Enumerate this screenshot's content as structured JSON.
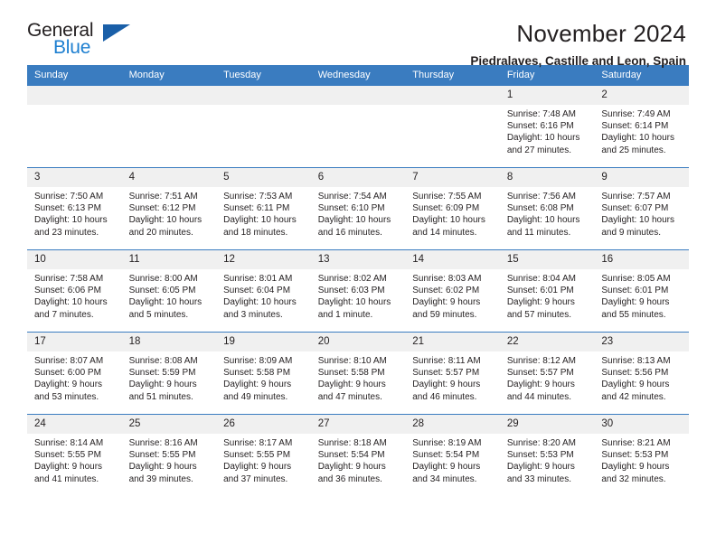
{
  "logo": {
    "primary_text": "General",
    "secondary_text": "Blue",
    "primary_color": "#231f20",
    "secondary_color": "#1d7fd0",
    "triangle_color": "#1a5fa8",
    "triangle_icon": "triangle-icon"
  },
  "header": {
    "title": "November 2024",
    "subtitle": "Piedralaves, Castille and Leon, Spain"
  },
  "theme": {
    "header_row_bg": "#3a7cc0",
    "header_row_text": "#ffffff",
    "daynum_bg": "#f0f0f0",
    "cell_bg": "#ffffff",
    "row_border": "#3a7cc0",
    "text": "#231f20"
  },
  "weekdays": [
    "Sunday",
    "Monday",
    "Tuesday",
    "Wednesday",
    "Thursday",
    "Friday",
    "Saturday"
  ],
  "labels": {
    "sunrise_prefix": "Sunrise: ",
    "sunset_prefix": "Sunset: ",
    "daylight_prefix": "Daylight: "
  },
  "weeks": [
    [
      {
        "day": "",
        "blank": true
      },
      {
        "day": "",
        "blank": true
      },
      {
        "day": "",
        "blank": true
      },
      {
        "day": "",
        "blank": true
      },
      {
        "day": "",
        "blank": true
      },
      {
        "day": "1",
        "sunrise": "Sunrise: 7:48 AM",
        "sunset": "Sunset: 6:16 PM",
        "daylight": "Daylight: 10 hours and 27 minutes."
      },
      {
        "day": "2",
        "sunrise": "Sunrise: 7:49 AM",
        "sunset": "Sunset: 6:14 PM",
        "daylight": "Daylight: 10 hours and 25 minutes."
      }
    ],
    [
      {
        "day": "3",
        "sunrise": "Sunrise: 7:50 AM",
        "sunset": "Sunset: 6:13 PM",
        "daylight": "Daylight: 10 hours and 23 minutes."
      },
      {
        "day": "4",
        "sunrise": "Sunrise: 7:51 AM",
        "sunset": "Sunset: 6:12 PM",
        "daylight": "Daylight: 10 hours and 20 minutes."
      },
      {
        "day": "5",
        "sunrise": "Sunrise: 7:53 AM",
        "sunset": "Sunset: 6:11 PM",
        "daylight": "Daylight: 10 hours and 18 minutes."
      },
      {
        "day": "6",
        "sunrise": "Sunrise: 7:54 AM",
        "sunset": "Sunset: 6:10 PM",
        "daylight": "Daylight: 10 hours and 16 minutes."
      },
      {
        "day": "7",
        "sunrise": "Sunrise: 7:55 AM",
        "sunset": "Sunset: 6:09 PM",
        "daylight": "Daylight: 10 hours and 14 minutes."
      },
      {
        "day": "8",
        "sunrise": "Sunrise: 7:56 AM",
        "sunset": "Sunset: 6:08 PM",
        "daylight": "Daylight: 10 hours and 11 minutes."
      },
      {
        "day": "9",
        "sunrise": "Sunrise: 7:57 AM",
        "sunset": "Sunset: 6:07 PM",
        "daylight": "Daylight: 10 hours and 9 minutes."
      }
    ],
    [
      {
        "day": "10",
        "sunrise": "Sunrise: 7:58 AM",
        "sunset": "Sunset: 6:06 PM",
        "daylight": "Daylight: 10 hours and 7 minutes."
      },
      {
        "day": "11",
        "sunrise": "Sunrise: 8:00 AM",
        "sunset": "Sunset: 6:05 PM",
        "daylight": "Daylight: 10 hours and 5 minutes."
      },
      {
        "day": "12",
        "sunrise": "Sunrise: 8:01 AM",
        "sunset": "Sunset: 6:04 PM",
        "daylight": "Daylight: 10 hours and 3 minutes."
      },
      {
        "day": "13",
        "sunrise": "Sunrise: 8:02 AM",
        "sunset": "Sunset: 6:03 PM",
        "daylight": "Daylight: 10 hours and 1 minute."
      },
      {
        "day": "14",
        "sunrise": "Sunrise: 8:03 AM",
        "sunset": "Sunset: 6:02 PM",
        "daylight": "Daylight: 9 hours and 59 minutes."
      },
      {
        "day": "15",
        "sunrise": "Sunrise: 8:04 AM",
        "sunset": "Sunset: 6:01 PM",
        "daylight": "Daylight: 9 hours and 57 minutes."
      },
      {
        "day": "16",
        "sunrise": "Sunrise: 8:05 AM",
        "sunset": "Sunset: 6:01 PM",
        "daylight": "Daylight: 9 hours and 55 minutes."
      }
    ],
    [
      {
        "day": "17",
        "sunrise": "Sunrise: 8:07 AM",
        "sunset": "Sunset: 6:00 PM",
        "daylight": "Daylight: 9 hours and 53 minutes."
      },
      {
        "day": "18",
        "sunrise": "Sunrise: 8:08 AM",
        "sunset": "Sunset: 5:59 PM",
        "daylight": "Daylight: 9 hours and 51 minutes."
      },
      {
        "day": "19",
        "sunrise": "Sunrise: 8:09 AM",
        "sunset": "Sunset: 5:58 PM",
        "daylight": "Daylight: 9 hours and 49 minutes."
      },
      {
        "day": "20",
        "sunrise": "Sunrise: 8:10 AM",
        "sunset": "Sunset: 5:58 PM",
        "daylight": "Daylight: 9 hours and 47 minutes."
      },
      {
        "day": "21",
        "sunrise": "Sunrise: 8:11 AM",
        "sunset": "Sunset: 5:57 PM",
        "daylight": "Daylight: 9 hours and 46 minutes."
      },
      {
        "day": "22",
        "sunrise": "Sunrise: 8:12 AM",
        "sunset": "Sunset: 5:57 PM",
        "daylight": "Daylight: 9 hours and 44 minutes."
      },
      {
        "day": "23",
        "sunrise": "Sunrise: 8:13 AM",
        "sunset": "Sunset: 5:56 PM",
        "daylight": "Daylight: 9 hours and 42 minutes."
      }
    ],
    [
      {
        "day": "24",
        "sunrise": "Sunrise: 8:14 AM",
        "sunset": "Sunset: 5:55 PM",
        "daylight": "Daylight: 9 hours and 41 minutes."
      },
      {
        "day": "25",
        "sunrise": "Sunrise: 8:16 AM",
        "sunset": "Sunset: 5:55 PM",
        "daylight": "Daylight: 9 hours and 39 minutes."
      },
      {
        "day": "26",
        "sunrise": "Sunrise: 8:17 AM",
        "sunset": "Sunset: 5:55 PM",
        "daylight": "Daylight: 9 hours and 37 minutes."
      },
      {
        "day": "27",
        "sunrise": "Sunrise: 8:18 AM",
        "sunset": "Sunset: 5:54 PM",
        "daylight": "Daylight: 9 hours and 36 minutes."
      },
      {
        "day": "28",
        "sunrise": "Sunrise: 8:19 AM",
        "sunset": "Sunset: 5:54 PM",
        "daylight": "Daylight: 9 hours and 34 minutes."
      },
      {
        "day": "29",
        "sunrise": "Sunrise: 8:20 AM",
        "sunset": "Sunset: 5:53 PM",
        "daylight": "Daylight: 9 hours and 33 minutes."
      },
      {
        "day": "30",
        "sunrise": "Sunrise: 8:21 AM",
        "sunset": "Sunset: 5:53 PM",
        "daylight": "Daylight: 9 hours and 32 minutes."
      }
    ]
  ]
}
